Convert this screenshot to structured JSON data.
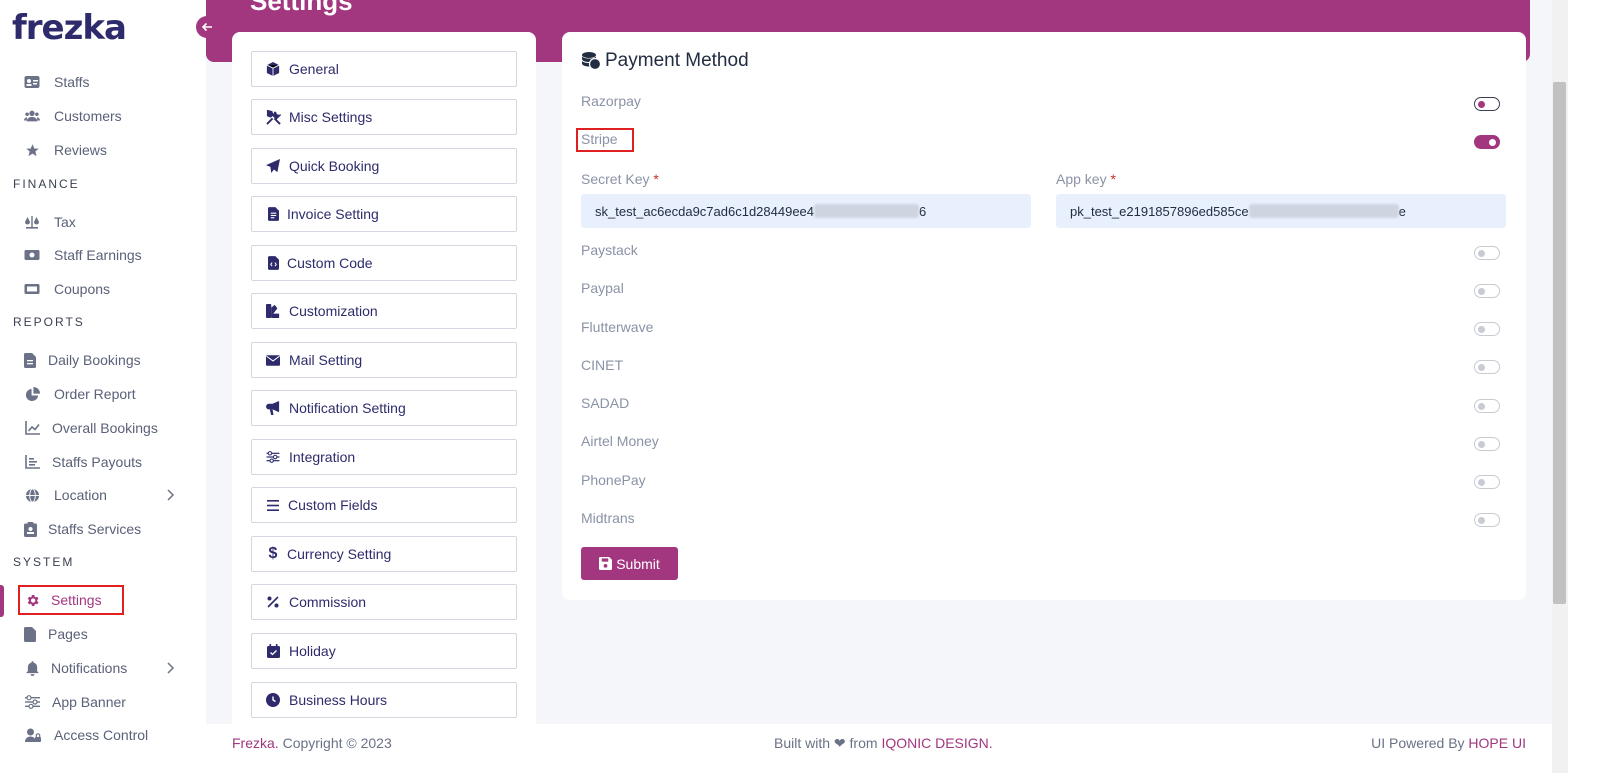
{
  "app": {
    "logo": "frezka"
  },
  "sidebar": {
    "items": [
      {
        "label": "Staffs",
        "icon": "id-card-icon"
      },
      {
        "label": "Customers",
        "icon": "users-icon"
      },
      {
        "label": "Reviews",
        "icon": "star-icon"
      },
      {
        "heading": "FINANCE"
      },
      {
        "label": "Tax",
        "icon": "scale-icon"
      },
      {
        "label": "Staff Earnings",
        "icon": "money-icon"
      },
      {
        "label": "Coupons",
        "icon": "ticket-icon"
      },
      {
        "heading": "REPORTS"
      },
      {
        "label": "Daily Bookings",
        "icon": "file-icon"
      },
      {
        "label": "Order Report",
        "icon": "pie-chart-icon"
      },
      {
        "label": "Overall Bookings",
        "icon": "line-chart-icon"
      },
      {
        "label": "Staffs Payouts",
        "icon": "bar-chart-icon"
      },
      {
        "label": "Location",
        "icon": "globe-icon"
      },
      {
        "label": "Staffs Services",
        "icon": "clipboard-icon"
      },
      {
        "heading": "SYSTEM"
      },
      {
        "label": "Settings",
        "icon": "gear-icon"
      },
      {
        "label": "Pages",
        "icon": "page-icon"
      },
      {
        "label": "Notifications",
        "icon": "bell-icon"
      },
      {
        "label": "App Banner",
        "icon": "sliders-icon"
      },
      {
        "label": "Access Control",
        "icon": "user-lock-icon"
      }
    ]
  },
  "header": {
    "title": "Settings"
  },
  "settings_menu": [
    "General",
    "Misc Settings",
    "Quick Booking",
    "Invoice Setting",
    "Custom Code",
    "Customization",
    "Mail Setting",
    "Notification Setting",
    "Integration",
    "Custom Fields",
    "Currency Setting",
    "Commission",
    "Holiday",
    "Business Hours"
  ],
  "payment": {
    "title": "Payment Method",
    "methods": [
      {
        "name": "Razorpay",
        "enabled": false
      },
      {
        "name": "Stripe",
        "enabled": true
      },
      {
        "name": "Paystack",
        "enabled": false
      },
      {
        "name": "Paypal",
        "enabled": false
      },
      {
        "name": "Flutterwave",
        "enabled": false
      },
      {
        "name": "CINET",
        "enabled": false
      },
      {
        "name": "SADAD",
        "enabled": false
      },
      {
        "name": "Airtel Money",
        "enabled": false
      },
      {
        "name": "PhonePay",
        "enabled": false
      },
      {
        "name": "Midtrans",
        "enabled": false
      }
    ],
    "secret_key_label": "Secret Key",
    "secret_key_value": "sk_test_ac6ecda9c7ad6c1d28449ee4",
    "secret_key_tail": "6",
    "app_key_label": "App key",
    "app_key_value": "pk_test_e2191857896ed585ce",
    "app_key_tail": "e",
    "required_mark": "*",
    "submit_label": "Submit"
  },
  "footer": {
    "brand": "Frezka.",
    "copyright": "Copyright © 2023",
    "built_with": "Built with",
    "heart": "❤",
    "from": "from",
    "company": "IQONIC DESIGN.",
    "powered_by": "UI Powered By",
    "ui_name": "HOPE UI"
  },
  "colors": {
    "accent": "#a2367f",
    "navy": "#2d2b6b",
    "muted": "#8a92a6"
  }
}
